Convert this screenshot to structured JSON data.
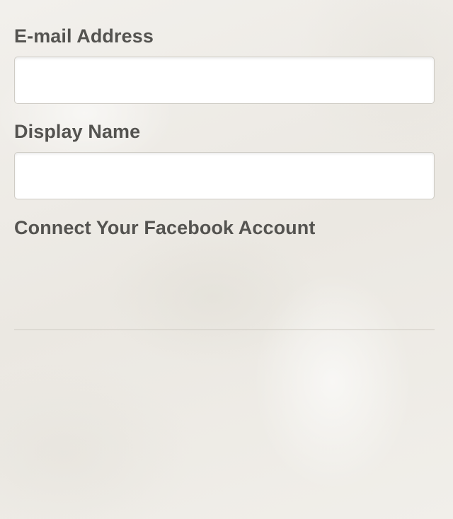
{
  "form": {
    "email": {
      "label": "E-mail Address",
      "value": "",
      "placeholder": ""
    },
    "display_name": {
      "label": "Display Name",
      "value": "",
      "placeholder": ""
    },
    "facebook": {
      "label": "Connect Your Facebook Account"
    }
  }
}
